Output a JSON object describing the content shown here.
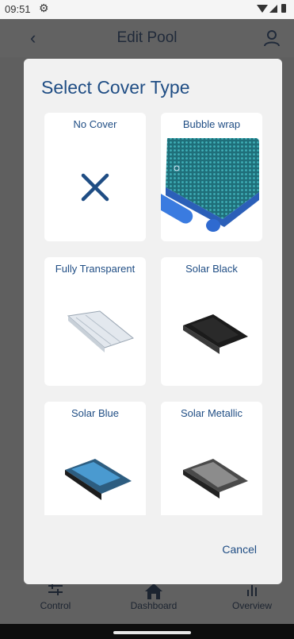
{
  "status": {
    "time": "09:51"
  },
  "app_bar": {
    "title": "Edit Pool"
  },
  "dialog": {
    "title": "Select Cover Type",
    "options": [
      {
        "label": "No Cover"
      },
      {
        "label": "Bubble wrap"
      },
      {
        "label": "Fully Transparent"
      },
      {
        "label": "Solar Black"
      },
      {
        "label": "Solar Blue"
      },
      {
        "label": "Solar Metallic"
      }
    ],
    "cancel_label": "Cancel"
  },
  "bottom_nav": {
    "items": [
      {
        "label": "Control"
      },
      {
        "label": "Dashboard"
      },
      {
        "label": "Overview"
      }
    ]
  },
  "colors": {
    "accent": "#1f4d84",
    "scrim": "#5f5f5f",
    "dialog_bg": "#f1f1f1"
  }
}
